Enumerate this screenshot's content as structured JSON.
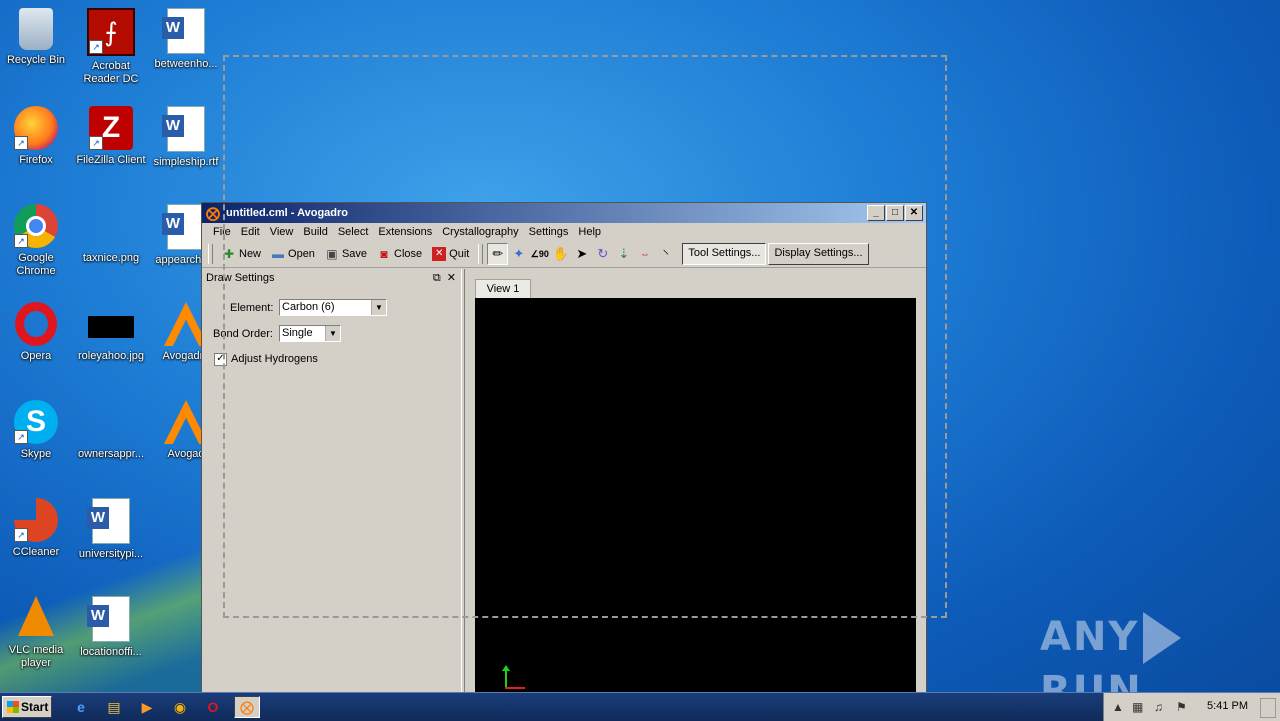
{
  "desktop": {
    "icons": [
      {
        "label": "Recycle Bin",
        "icon": "recycle-bin-icon"
      },
      {
        "label": "Acrobat Reader DC",
        "icon": "acrobat-icon"
      },
      {
        "label": "betweenho...",
        "icon": "word-doc-icon"
      },
      {
        "label": "Firefox",
        "icon": "firefox-icon"
      },
      {
        "label": "FileZilla Client",
        "icon": "filezilla-icon"
      },
      {
        "label": "simpleship.rtf",
        "icon": "word-doc-icon"
      },
      {
        "label": "Google Chrome",
        "icon": "chrome-icon"
      },
      {
        "label": "taxnice.png",
        "icon": "image-file-icon"
      },
      {
        "label": "appearcha...",
        "icon": "word-doc-icon"
      },
      {
        "label": "Opera",
        "icon": "opera-icon"
      },
      {
        "label": "roleyahoo.jpg",
        "icon": "image-file-icon"
      },
      {
        "label": "Avogadro",
        "icon": "avogadro-icon"
      },
      {
        "label": "Skype",
        "icon": "skype-icon"
      },
      {
        "label": "ownersappr...",
        "icon": "image-file-icon"
      },
      {
        "label": "Avogad",
        "icon": "avogadro-icon"
      },
      {
        "label": "CCleaner",
        "icon": "ccleaner-icon"
      },
      {
        "label": "universitypi...",
        "icon": "word-doc-icon"
      },
      {
        "label": "VLC media player",
        "icon": "vlc-icon"
      },
      {
        "label": "locationoffi...",
        "icon": "word-doc-icon"
      }
    ],
    "watermark": "ANY RUN"
  },
  "window": {
    "title": "untitled.cml - Avogadro",
    "menu": [
      "File",
      "Edit",
      "View",
      "Build",
      "Select",
      "Extensions",
      "Crystallography",
      "Settings",
      "Help"
    ],
    "toolbar": {
      "new": "New",
      "open": "Open",
      "save": "Save",
      "close": "Close",
      "quit": "Quit",
      "tool_settings": "Tool Settings...",
      "display_settings": "Display Settings..."
    },
    "tools": [
      "draw-tool-icon",
      "navigate-tool-icon",
      "measure-tool-icon",
      "manipulate-tool-icon",
      "select-tool-icon",
      "rotate-tool-icon",
      "autoopt-tool-icon",
      "align-tool-icon",
      "bond-centric-tool-icon"
    ],
    "dock": {
      "title": "Draw Settings",
      "element_label": "Element:",
      "element_value": "Carbon (6)",
      "bond_label": "Bond Order:",
      "bond_value": "Single",
      "adjust_hydrogens": "Adjust Hydrogens",
      "adjust_hydrogens_checked": true
    },
    "tab": "View 1"
  },
  "taskbar": {
    "start": "Start",
    "clock": "5:41 PM"
  },
  "colors": {
    "accent": "#0a246a",
    "viewport": "#000000",
    "axis_y": "#1fd11f",
    "axis_x": "#e02020"
  }
}
